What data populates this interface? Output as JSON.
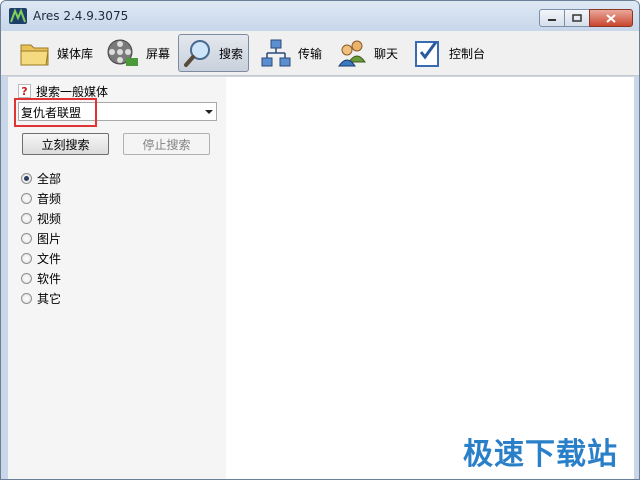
{
  "window": {
    "title": "Ares 2.4.9.3075"
  },
  "toolbar": {
    "items": [
      {
        "label": "媒体库",
        "icon": "folder-icon"
      },
      {
        "label": "屏幕",
        "icon": "film-reel-icon"
      },
      {
        "label": "搜索",
        "icon": "magnifier-icon",
        "active": true
      },
      {
        "label": "传输",
        "icon": "network-icon"
      },
      {
        "label": "聊天",
        "icon": "users-icon"
      },
      {
        "label": "控制台",
        "icon": "checklist-icon"
      }
    ]
  },
  "search": {
    "label": "搜索一般媒体",
    "query": "复仇者联盟",
    "start_button": "立刻搜索",
    "stop_button": "停止搜索",
    "types": [
      "全部",
      "音频",
      "视频",
      "图片",
      "文件",
      "软件",
      "其它"
    ],
    "selected_type": "全部"
  },
  "watermark": "极速下载站",
  "colors": {
    "accent": "#2a7fc9",
    "highlight": "#e03434"
  }
}
